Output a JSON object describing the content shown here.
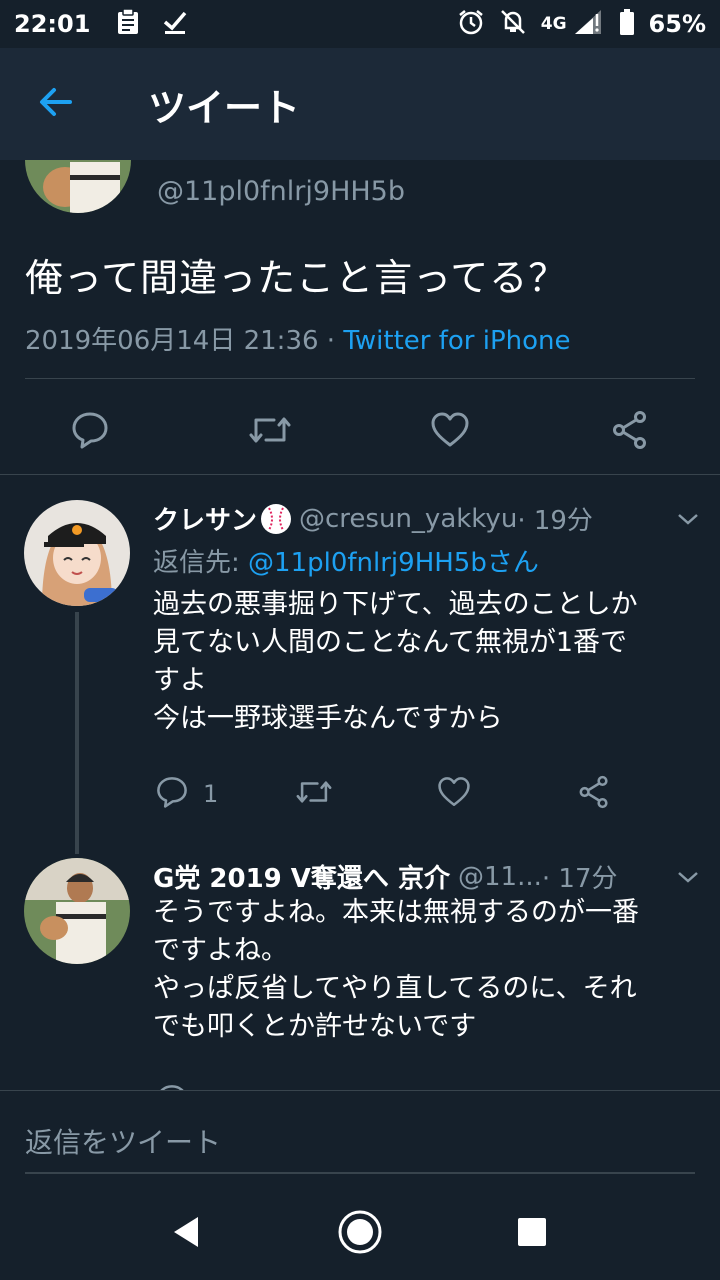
{
  "status_bar": {
    "time": "22:01",
    "network": "4G",
    "battery": "65%"
  },
  "header": {
    "title": "ツイート"
  },
  "main_tweet": {
    "handle": "@11pl0fnlrj9HH5b",
    "text": "俺って間違ったこと言ってる？",
    "date": "2019年06月14日 21:36",
    "separator": " · ",
    "source": "Twitter for iPhone"
  },
  "replies": [
    {
      "name": "クレサン",
      "handle": "@cresun_yakkyu",
      "time": " · 19分",
      "reply_to_label": "返信先: ",
      "reply_to_mention": "@11pl0fnlrj9HH5bさん",
      "lines": [
        "過去の悪事掘り下げて、過去のことしか",
        "見てない人間のことなんて無視が1番で",
        "すよ",
        "今は一野球選手なんですから"
      ],
      "reply_count": "1"
    },
    {
      "name": "G党 2019 V奪還へ 京介",
      "handle": "@11...",
      "time": " · 17分",
      "lines": [
        "そうですよね。本来は無視するのが一番",
        "ですよね。",
        "やっぱ反省してやり直してるのに、それ",
        "でも叩くとか許せないです"
      ]
    }
  ],
  "compose": {
    "placeholder": "返信をツイート"
  },
  "colors": {
    "background": "#15202b",
    "header": "#1c2938",
    "accent": "#1da1f2",
    "secondary_text": "#8899a6",
    "divider": "#38444d"
  }
}
